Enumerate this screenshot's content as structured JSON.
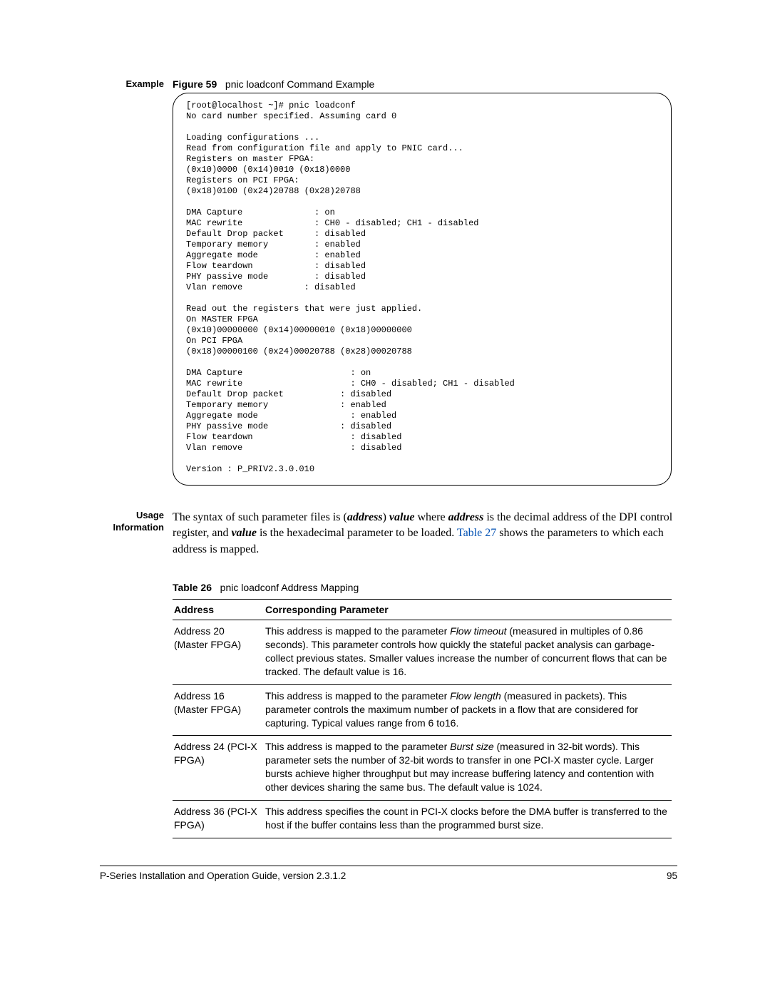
{
  "example_label": "Example",
  "figure": {
    "num": "Figure 59",
    "title": "pnic loadconf Command Example"
  },
  "terminal": "[root@localhost ~]# pnic loadconf\nNo card number specified. Assuming card 0\n\nLoading configurations ...\nRead from configuration file and apply to PNIC card...\nRegisters on master FPGA:\n(0x10)0000 (0x14)0010 (0x18)0000\nRegisters on PCI FPGA:\n(0x18)0100 (0x24)20788 (0x28)20788\n\nDMA Capture              : on\nMAC rewrite              : CH0 - disabled; CH1 - disabled\nDefault Drop packet      : disabled\nTemporary memory         : enabled\nAggregate mode           : enabled\nFlow teardown            : disabled\nPHY passive mode         : disabled\nVlan remove            : disabled\n\nRead out the registers that were just applied.\nOn MASTER FPGA\n(0x10)00000000 (0x14)00000010 (0x18)00000000\nOn PCI FPGA\n(0x18)00000100 (0x24)00020788 (0x28)00020788\n\nDMA Capture                     : on\nMAC rewrite                     : CH0 - disabled; CH1 - disabled\nDefault Drop packet           : disabled\nTemporary memory              : enabled\nAggregate mode                  : enabled\nPHY passive mode              : disabled\nFlow teardown                   : disabled\nVlan remove                     : disabled\n\nVersion : P_PRIV2.3.0.010",
  "usage_label": "Usage Information",
  "usage_p1a": "The syntax of such parameter files is (",
  "usage_addr": "address",
  "usage_p1b": ") ",
  "usage_val": "value",
  "usage_p1c": " where ",
  "usage_p1d": " is the decimal address of the DPI control register, and ",
  "usage_p1e": " is the hexadecimal parameter to be loaded. ",
  "usage_link": "Table 27",
  "usage_p1f": " shows the parameters to which each address is mapped.",
  "table_caption": {
    "num": "Table 26",
    "title": "pnic loadconf Address Mapping"
  },
  "th1": "Address",
  "th2": "Corresponding Parameter",
  "rows": [
    {
      "addr": "Address 20 (Master FPGA)",
      "pre": "This address is mapped to the parameter ",
      "ital": "Flow timeout",
      "post": " (measured in multiples of 0.86 seconds). This parameter controls how quickly the stateful packet analysis can garbage-collect previous states. Smaller values increase the number of concurrent flows that can be tracked. The default value is 16."
    },
    {
      "addr": "Address 16 (Master FPGA)",
      "pre": "This address is mapped to the parameter ",
      "ital": "Flow length",
      "post": " (measured in packets). This parameter controls the maximum number of packets in a flow that are considered for capturing. Typical values range from 6 to16."
    },
    {
      "addr": "Address 24 (PCI-X FPGA)",
      "pre": "This address is mapped to the parameter ",
      "ital": "Burst size",
      "post": " (measured in 32-bit words). This parameter sets the number of 32-bit words to transfer in one PCI-X master cycle. Larger bursts achieve higher throughput but may increase buffering latency and contention with other devices sharing the same bus. The default value is 1024."
    },
    {
      "addr": "Address 36 (PCI-X FPGA)",
      "pre": "This address specifies the count in PCI-X clocks before the DMA buffer is transferred to the host if the buffer contains less than the programmed burst size.",
      "ital": "",
      "post": ""
    }
  ],
  "footer_left": "P-Series Installation and Operation Guide, version 2.3.1.2",
  "footer_right": "95"
}
